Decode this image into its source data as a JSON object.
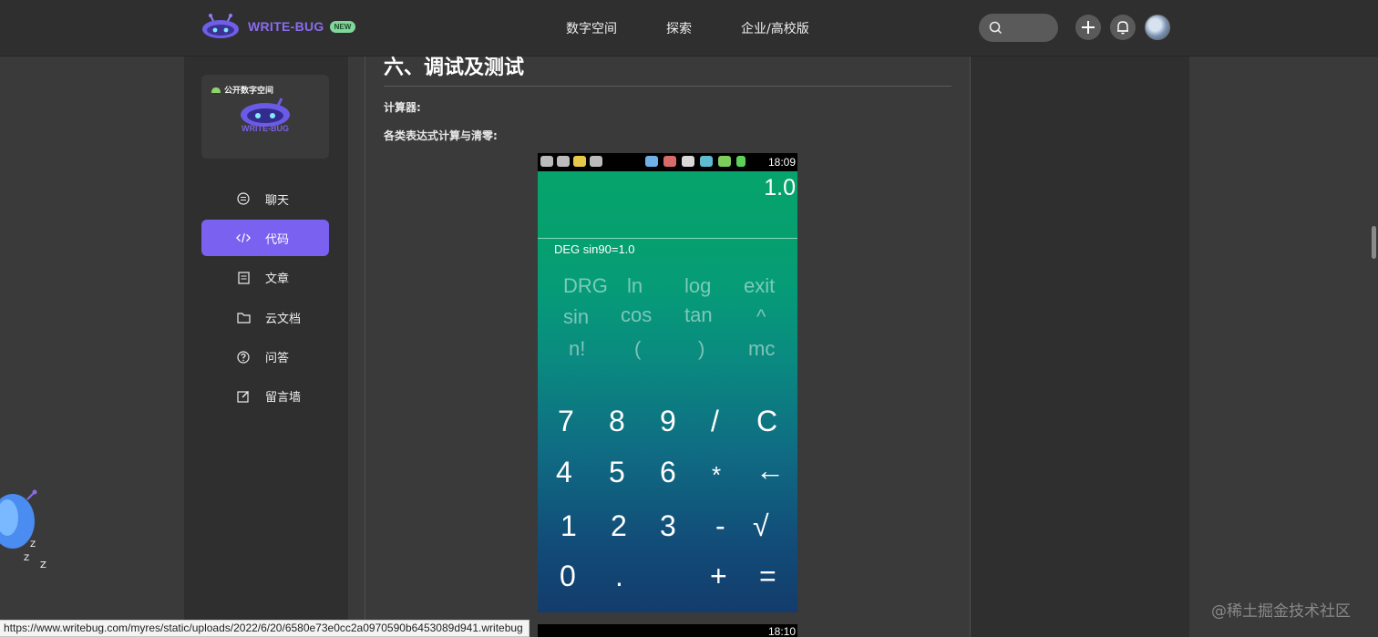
{
  "header": {
    "logo_text": "WRITE-BUG",
    "badge": "NEW",
    "nav": [
      "数字空间",
      "探索",
      "企业/高校版"
    ]
  },
  "sidebar": {
    "space_tag": "公开数字空间",
    "space_brand": "WRITE-BUG",
    "items": [
      {
        "label": "聊天",
        "icon": "chat-icon",
        "active": false
      },
      {
        "label": "代码",
        "icon": "code-icon",
        "active": true
      },
      {
        "label": "文章",
        "icon": "article-icon",
        "active": false
      },
      {
        "label": "云文档",
        "icon": "folder-icon",
        "active": false
      },
      {
        "label": "问答",
        "icon": "question-icon",
        "active": false
      },
      {
        "label": "留言墙",
        "icon": "edit-icon",
        "active": false
      }
    ]
  },
  "article": {
    "heading": "六、调试及测试",
    "p1": "计算器:",
    "p2": "各类表达式计算与清零:"
  },
  "phone": {
    "time": "18:09",
    "display": "1.0",
    "expr": "DEG  sin90=1.0",
    "fn_rows": [
      [
        "DRG",
        "ln",
        "log",
        "exit"
      ],
      [
        "sin",
        "cos",
        "tan",
        "^"
      ],
      [
        "n!",
        "(",
        ")",
        "mc"
      ]
    ],
    "keys": [
      [
        "7",
        "8",
        "9",
        "/",
        "C"
      ],
      [
        "4",
        "5",
        "6",
        "*",
        "←"
      ],
      [
        "1",
        "2",
        "3",
        "-",
        "√"
      ],
      [
        "0",
        ".",
        "",
        "+",
        "="
      ]
    ]
  },
  "phone2": {
    "time": "18:10"
  },
  "status_url": "https://www.writebug.com/myres/static/uploads/2022/6/20/6580e73e0cc2a0970590b6453089d941.writebug",
  "watermark": "@稀土掘金技术社区"
}
